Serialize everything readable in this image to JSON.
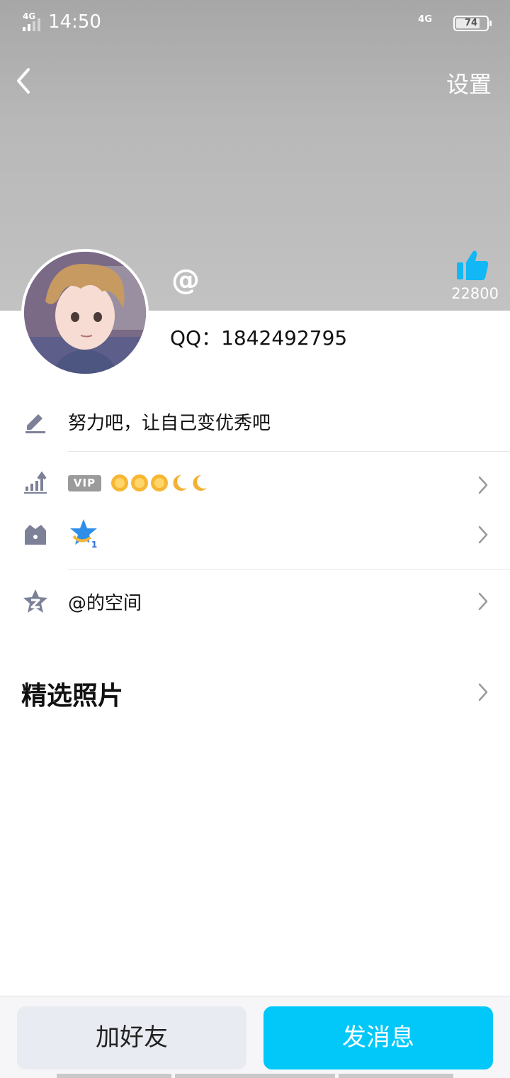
{
  "status_bar": {
    "time": "14:50",
    "network_left": "4G",
    "network_right": "4G",
    "battery": "74",
    "battery_level": 0.74
  },
  "header": {
    "back_icon": "chevron-left-icon",
    "settings_label": "设置"
  },
  "profile": {
    "nickname": "@",
    "qq_label": "QQ：1842492795",
    "likes": "22800",
    "like_icon": "thumbs-up-icon",
    "accent_color": "#12b7f5"
  },
  "rows": {
    "signature": {
      "icon": "pencil-icon",
      "text": "努力吧，让自己变优秀吧"
    },
    "level": {
      "icon": "level-chart-icon",
      "vip_label": "VIP",
      "badges": [
        "sun",
        "sun",
        "sun",
        "moon",
        "moon"
      ]
    },
    "honor": {
      "icon": "crown-icon",
      "badge": "star-badge-icon",
      "badge_number": "1"
    },
    "space": {
      "icon": "qzone-icon",
      "text": "@的空间"
    }
  },
  "photos": {
    "title": "精选照片"
  },
  "actions": {
    "add_friend": "加好友",
    "send_message": "发消息",
    "primary_color": "#02c8fa"
  }
}
